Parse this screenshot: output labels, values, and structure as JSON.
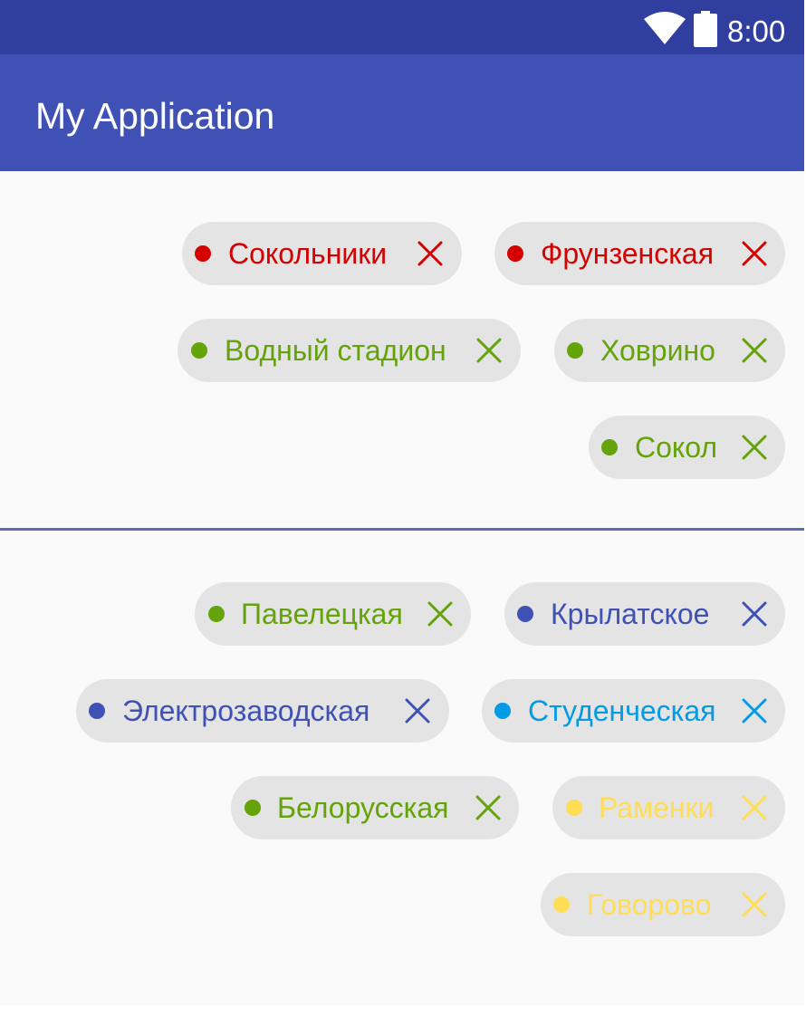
{
  "status_bar": {
    "time": "8:00",
    "wifi_icon": "wifi-icon",
    "battery_icon": "battery-icon"
  },
  "app_bar": {
    "title": "My Application"
  },
  "colors": {
    "status_bar": "#303f9f",
    "app_bar": "#3f51b5",
    "background": "#fafafa",
    "chip_background": "#e4e4e4",
    "red_line": "#d50000",
    "green_line": "#64a30a",
    "blue_line": "#3f51b5",
    "cyan_line": "#039be5",
    "yellow_line": "#ffdd55"
  },
  "group_top": {
    "chips": [
      {
        "label": "Сокольники",
        "color": "#d50000",
        "close_icon": "close-icon"
      },
      {
        "label": "Фрунзенская",
        "color": "#d50000",
        "close_icon": "close-icon"
      },
      {
        "label": "Водный стадион",
        "color": "#64a30a",
        "close_icon": "close-icon"
      },
      {
        "label": "Ховрино",
        "color": "#64a30a",
        "close_icon": "close-icon"
      },
      {
        "label": "Сокол",
        "color": "#64a30a",
        "close_icon": "close-icon"
      }
    ]
  },
  "group_bottom": {
    "chips": [
      {
        "label": "Павелецкая",
        "color": "#64a30a",
        "close_icon": "close-icon"
      },
      {
        "label": "Крылатское",
        "color": "#3f51b5",
        "close_icon": "close-icon"
      },
      {
        "label": "Электрозаводская",
        "color": "#3f51b5",
        "close_icon": "close-icon"
      },
      {
        "label": "Студенческая",
        "color": "#039be5",
        "close_icon": "close-icon"
      },
      {
        "label": "Белорусская",
        "color": "#64a30a",
        "close_icon": "close-icon"
      },
      {
        "label": "Раменки",
        "color": "#ffdd55",
        "close_icon": "close-icon"
      },
      {
        "label": "Говорово",
        "color": "#ffdd55",
        "close_icon": "close-icon"
      }
    ]
  }
}
